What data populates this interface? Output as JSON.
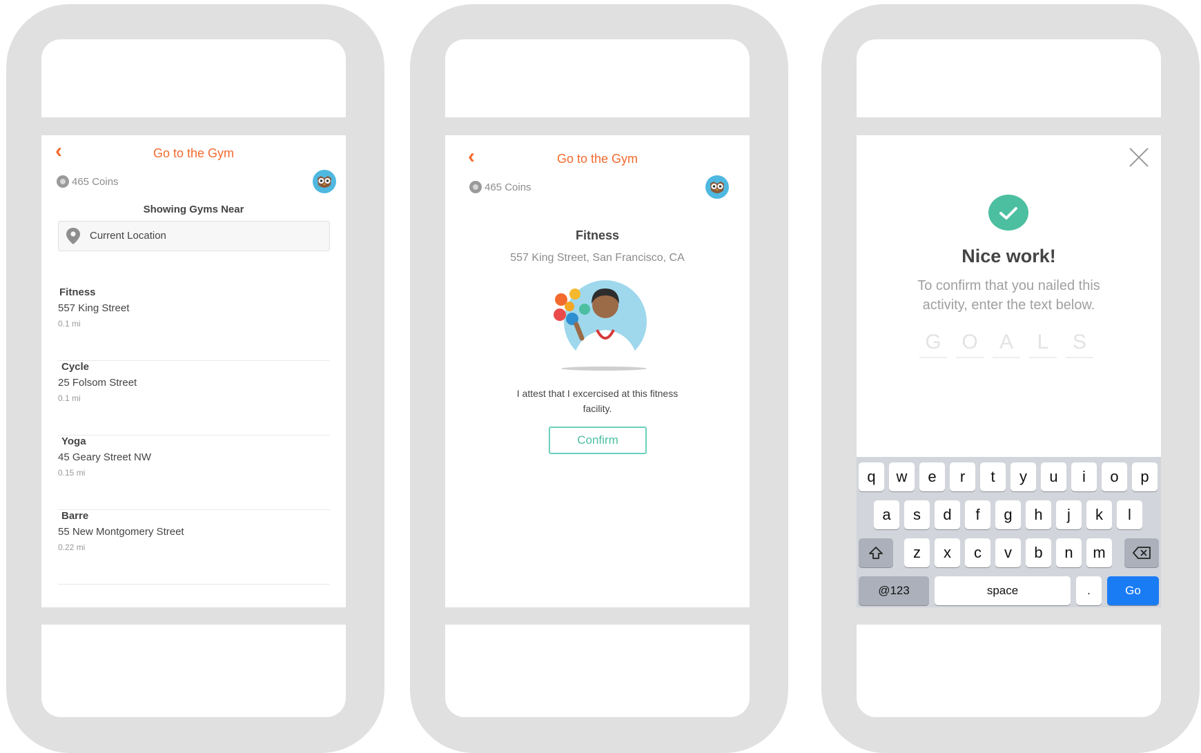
{
  "screen1": {
    "title": "Go to the Gym",
    "coins": "465 Coins",
    "showing_label": "Showing Gyms Near",
    "location_value": "Current Location",
    "gyms": [
      {
        "name": "Fitness",
        "address": "557 King Street",
        "distance": "0.1 mi"
      },
      {
        "name": "Cycle",
        "address": "25 Folsom Street",
        "distance": "0.1 mi"
      },
      {
        "name": "Yoga",
        "address": "45 Geary Street NW",
        "distance": "0.15 mi"
      },
      {
        "name": "Barre",
        "address": "55 New Montgomery Street",
        "distance": "0.22 mi"
      }
    ]
  },
  "screen2": {
    "title": "Go to the Gym",
    "coins": "465 Coins",
    "gym_name": "Fitness",
    "gym_address": "557 King Street, San Francisco, CA",
    "attest_line1": "I attest that I excercised at this fitness",
    "attest_line2": "facility.",
    "confirm_label": "Confirm"
  },
  "screen3": {
    "heading": "Nice work!",
    "instruction_line1": "To confirm that you nailed this",
    "instruction_line2": "activity, enter the text below.",
    "code_letters": [
      "G",
      "O",
      "A",
      "L",
      "S"
    ],
    "keyboard": {
      "row1": [
        "q",
        "w",
        "e",
        "r",
        "t",
        "y",
        "u",
        "i",
        "o",
        "p"
      ],
      "row2": [
        "a",
        "s",
        "d",
        "f",
        "g",
        "h",
        "j",
        "k",
        "l"
      ],
      "row3": [
        "z",
        "x",
        "c",
        "v",
        "b",
        "n",
        "m"
      ],
      "numbers_label": "@123",
      "space_label": "space",
      "period_label": ".",
      "go_label": "Go"
    }
  },
  "colors": {
    "accent": "#f26a2e",
    "success": "#4cbfa0",
    "go_blue": "#1a7cf5",
    "frame": "#e0e0e0"
  }
}
